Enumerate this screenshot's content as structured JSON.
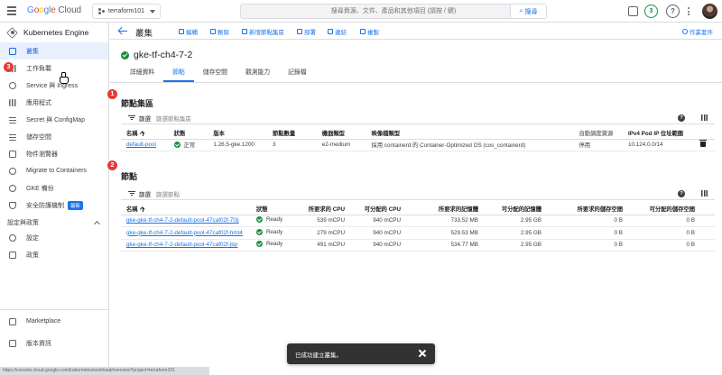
{
  "header": {
    "logo": {
      "g": "G",
      "o1": "o",
      "o2": "o",
      "g2": "g",
      "l": "l",
      "e": "e",
      "cloud": " Cloud"
    },
    "project": "terraform101",
    "search_placeholder": "搜尋資源、文件、產品和其他項目 (請按 / 鍵)",
    "search_button": "搜尋",
    "notification_count": "3",
    "help_glyph": "?"
  },
  "sidebar": {
    "product": "Kubernetes Engine",
    "items": [
      {
        "label": "叢集",
        "icon": "cluster-icon",
        "active": true
      },
      {
        "label": "工作負載",
        "icon": "workloads-icon"
      },
      {
        "label": "Service 與 Ingress",
        "icon": "network-icon"
      },
      {
        "label": "應用程式",
        "icon": "apps-icon"
      },
      {
        "label": "Secret 與 ConfigMap",
        "icon": "secret-icon"
      },
      {
        "label": "儲存空間",
        "icon": "storage-icon"
      },
      {
        "label": "物件瀏覽器",
        "icon": "object-browser-icon"
      },
      {
        "label": "Migrate to Containers",
        "icon": "migrate-icon"
      },
      {
        "label": "GKE 備份",
        "icon": "backup-icon"
      },
      {
        "label": "安全防護機制",
        "icon": "security-icon",
        "badge": "最新"
      }
    ],
    "section": "設定與政策",
    "section_items": [
      {
        "label": "設定",
        "icon": "settings-icon"
      },
      {
        "label": "政策",
        "icon": "policy-icon"
      }
    ],
    "bottom": [
      {
        "label": "Marketplace",
        "icon": "marketplace-icon"
      },
      {
        "label": "版本資訊",
        "icon": "release-notes-icon"
      }
    ],
    "step_badge": "3"
  },
  "actionbar": {
    "title": "叢集",
    "actions": [
      "編輯",
      "刪除",
      "新增節點集區",
      "部署",
      "連結",
      "複製"
    ],
    "right_action": "作業套件"
  },
  "cluster": {
    "name": "gke-tf-ch4-7-2",
    "tabs": [
      "詳細資料",
      "節點",
      "儲存空間",
      "觀測能力",
      "記錄檔"
    ],
    "active_tab": 1
  },
  "node_pools": {
    "step_badge": "1",
    "title": "節點集區",
    "filter_label": "篩選",
    "filter_placeholder": "篩選節點集區",
    "help_glyph": "?",
    "columns": [
      "名稱",
      "狀態",
      "版本",
      "節點數量",
      "機器類型",
      "映像檔類型",
      "自動調度資源",
      "IPv4 Pod IP 位址範圍"
    ],
    "rows": [
      {
        "name": "default-pool",
        "status": "正常",
        "version": "1.26.5-gke.1200",
        "nodes": "3",
        "machine": "e2-medium",
        "image": "採用 containerd 的 Container-Optimized OS (cos_containerd)",
        "autoscale": "停用",
        "ipv4": "10.124.0.0/14"
      }
    ]
  },
  "nodes": {
    "step_badge": "2",
    "title": "節點",
    "filter_label": "篩選",
    "filter_placeholder": "篩選節點",
    "help_glyph": "?",
    "columns": [
      "名稱",
      "狀態",
      "所要求的 CPU",
      "可分配的 CPU",
      "所要求的記憶體",
      "可分配的記憶體",
      "所要求的儲存空間",
      "可分配的儲存空間"
    ],
    "rows": [
      {
        "name": "gke-gke-tf-ch4-7-2-default-pool-47caf02f-7l3j",
        "status": "Ready",
        "cpu_req": "539 mCPU",
        "cpu_alloc": "940 mCPU",
        "mem_req": "733.52 MB",
        "mem_alloc": "2.95 GB",
        "sto_req": "0 B",
        "sto_alloc": "0 B"
      },
      {
        "name": "gke-gke-tf-ch4-7-2-default-pool-47caf02f-hmt4",
        "status": "Ready",
        "cpu_req": "279 mCPU",
        "cpu_alloc": "940 mCPU",
        "mem_req": "529.53 MB",
        "mem_alloc": "2.95 GB",
        "sto_req": "0 B",
        "sto_alloc": "0 B"
      },
      {
        "name": "gke-gke-tf-ch4-7-2-default-pool-47caf02f-jtqr",
        "status": "Ready",
        "cpu_req": "491 mCPU",
        "cpu_alloc": "940 mCPU",
        "mem_req": "534.77 MB",
        "mem_alloc": "2.95 GB",
        "sto_req": "0 B",
        "sto_alloc": "0 B"
      }
    ]
  },
  "toast": {
    "message": "已成功建立叢集。"
  },
  "statusbar": "https://console.cloud.google.com/kubernetes/workload/overview?project=terraform101"
}
